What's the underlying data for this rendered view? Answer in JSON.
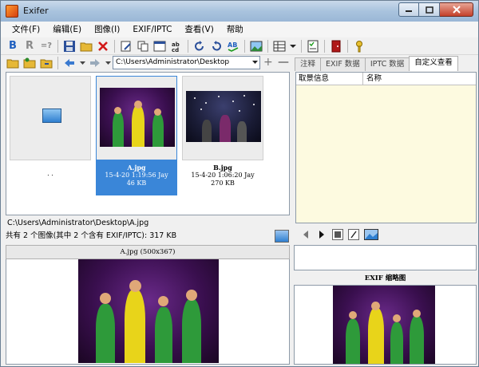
{
  "window": {
    "title": "Exifer"
  },
  "menu": [
    "文件(F)",
    "编辑(E)",
    "图像(I)",
    "EXIF/IPTC",
    "查看(V)",
    "帮助"
  ],
  "toolbar": {
    "bold": "B",
    "r": "R",
    "eq": "=?"
  },
  "address": {
    "path": "C:\\Users\\Administrator\\Desktop"
  },
  "tabs": [
    "注释",
    "EXIF 数据",
    "IPTC 数据",
    "自定义查看"
  ],
  "thumbnails": [
    {
      "name": "",
      "date": "",
      "size": "",
      "caption": ". ."
    },
    {
      "name": "A.jpg",
      "date": "15-4-20 1:19:56 Jay",
      "size": "46 KB"
    },
    {
      "name": "B.jpg",
      "date": "15-4-20 1:06:20 Jay",
      "size": "270 KB"
    }
  ],
  "current_path": "C:\\Users\\Administrator\\Desktop\\A.jpg",
  "status": "共有 2 个图像(其中 2 个含有 EXIF/IPTC): 317 KB",
  "preview": {
    "title": "A.jpg (500x367)"
  },
  "exif": {
    "col1": "取景信息",
    "col2": "名称"
  },
  "exif_thumb": {
    "title": "EXIF 缩略图"
  },
  "colors": {
    "selection": "#3a86d8",
    "exif_bg": "#fdfae0",
    "titlebar": "#a9c3de"
  }
}
